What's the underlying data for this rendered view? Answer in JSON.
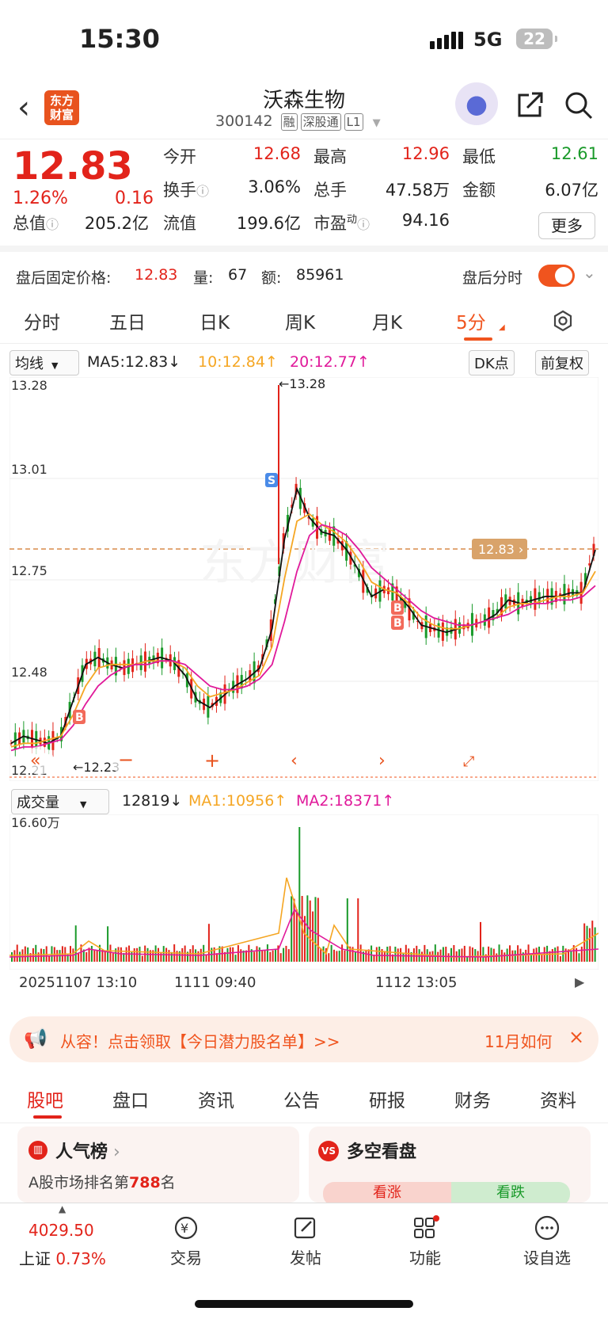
{
  "status_bar": {
    "time": "15:30",
    "network": "5G",
    "battery": "22"
  },
  "header": {
    "logo_text": "东方财富",
    "stock_name": "沃森生物",
    "stock_code": "300142",
    "tags": [
      "融",
      "深股通",
      "L1"
    ]
  },
  "quote": {
    "price": "12.83",
    "change_pct": "1.26%",
    "change": "0.16",
    "fields": [
      {
        "label": "今开",
        "value": "12.68",
        "color": "red"
      },
      {
        "label": "最高",
        "value": "12.96",
        "color": "red"
      },
      {
        "label": "最低",
        "value": "12.61",
        "color": "green"
      },
      {
        "label": "换手",
        "value": "3.06%",
        "color": "normal"
      },
      {
        "label": "总手",
        "value": "47.58万",
        "color": "normal"
      },
      {
        "label": "金额",
        "value": "6.07亿",
        "color": "normal"
      },
      {
        "label": "总值",
        "value": "205.2亿",
        "color": "normal"
      },
      {
        "label": "流值",
        "value": "199.6亿",
        "color": "normal"
      },
      {
        "label": "市盈",
        "value": "94.16",
        "color": "normal"
      }
    ],
    "pe_superscript": "动",
    "more_label": "更多"
  },
  "after_hours": {
    "label": "盘后固定价格:",
    "price": "12.83",
    "vol_label": "量:",
    "vol": "67",
    "amt_label": "额:",
    "amt": "85961",
    "toggle_label": "盘后分时"
  },
  "period_tabs": [
    "分时",
    "五日",
    "日K",
    "周K",
    "月K",
    "5分"
  ],
  "active_period": "5分",
  "ma_row": {
    "selector": "均线",
    "ma5": "MA5:12.83",
    "ma10": "10:12.84",
    "ma20": "20:12.77",
    "dk": "DK点",
    "adjust": "前复权"
  },
  "price_axis": [
    "13.28",
    "13.01",
    "12.75",
    "12.48",
    "12.21"
  ],
  "chart_annotations": {
    "high": "13.28",
    "low": "12.23",
    "current": "12.83"
  },
  "chart_data": {
    "type": "line",
    "title": "",
    "ylim": [
      12.21,
      13.28
    ],
    "series": [
      {
        "name": "MA5",
        "color": "#111111",
        "values": [
          12.28,
          12.3,
          12.29,
          12.28,
          12.3,
          12.4,
          12.5,
          12.52,
          12.5,
          12.49,
          12.5,
          12.51,
          12.52,
          12.51,
          12.47,
          12.4,
          12.38,
          12.41,
          12.44,
          12.46,
          12.49,
          12.6,
          12.85,
          12.99,
          12.91,
          12.87,
          12.86,
          12.82,
          12.76,
          12.69,
          12.71,
          12.7,
          12.66,
          12.61,
          12.6,
          12.59,
          12.6,
          12.61,
          12.62,
          12.64,
          12.68,
          12.67,
          12.68,
          12.69,
          12.69,
          12.7,
          12.7,
          12.82
        ]
      },
      {
        "name": "MA10",
        "color": "#f5a623",
        "values": [
          12.27,
          12.28,
          12.28,
          12.29,
          12.3,
          12.36,
          12.44,
          12.49,
          12.5,
          12.5,
          12.5,
          12.51,
          12.51,
          12.51,
          12.49,
          12.44,
          12.41,
          12.42,
          12.43,
          12.45,
          12.47,
          12.55,
          12.74,
          12.9,
          12.92,
          12.89,
          12.87,
          12.84,
          12.79,
          12.73,
          12.71,
          12.7,
          12.67,
          12.63,
          12.61,
          12.6,
          12.6,
          12.61,
          12.62,
          12.63,
          12.66,
          12.67,
          12.67,
          12.68,
          12.69,
          12.69,
          12.7,
          12.76
        ]
      },
      {
        "name": "MA20",
        "color": "#e0199a",
        "values": [
          12.26,
          12.27,
          12.27,
          12.28,
          12.29,
          12.33,
          12.39,
          12.44,
          12.47,
          12.49,
          12.5,
          12.5,
          12.51,
          12.51,
          12.5,
          12.47,
          12.44,
          12.43,
          12.43,
          12.44,
          12.46,
          12.5,
          12.62,
          12.76,
          12.86,
          12.89,
          12.88,
          12.86,
          12.82,
          12.77,
          12.74,
          12.71,
          12.68,
          12.65,
          12.63,
          12.62,
          12.61,
          12.61,
          12.62,
          12.63,
          12.64,
          12.66,
          12.67,
          12.67,
          12.68,
          12.68,
          12.69,
          12.72
        ]
      }
    ],
    "markers": [
      {
        "label": "B",
        "color": "#f26a5a"
      },
      {
        "label": "S",
        "color": "#4a8be8"
      },
      {
        "label": "B",
        "color": "#f26a5a"
      },
      {
        "label": "B",
        "color": "#f26a5a"
      }
    ]
  },
  "volume": {
    "selector": "成交量",
    "value": "12819",
    "ma1": "MA1:10956",
    "ma2": "MA2:18371",
    "axis_top": "16.60万"
  },
  "dates": [
    "20251107 13:10",
    "1111 09:40",
    "1112 13:05"
  ],
  "banner": {
    "text": "从容！点击领取【今日潜力股名单】>>",
    "right_text": "11月如何"
  },
  "content_tabs": [
    "股吧",
    "盘口",
    "资讯",
    "公告",
    "研报",
    "财务",
    "资料"
  ],
  "cards": {
    "popularity": {
      "title": "人气榜",
      "subtitle_prefix": "A股市场排名第",
      "rank": "788",
      "subtitle_suffix": "名"
    },
    "bull_bear": {
      "title": "多空看盘",
      "bull": "看涨",
      "bear": "看跌"
    }
  },
  "bottom_nav": {
    "index_value": "4029.50",
    "index_name": "上证",
    "index_pct": "0.73%",
    "items": [
      "交易",
      "发帖",
      "功能",
      "设自选"
    ]
  },
  "colors": {
    "accent": "#f0541e",
    "up": "#e2231a",
    "down": "#1a9a2a",
    "ma10": "#f5a623",
    "ma20": "#e0199a"
  }
}
